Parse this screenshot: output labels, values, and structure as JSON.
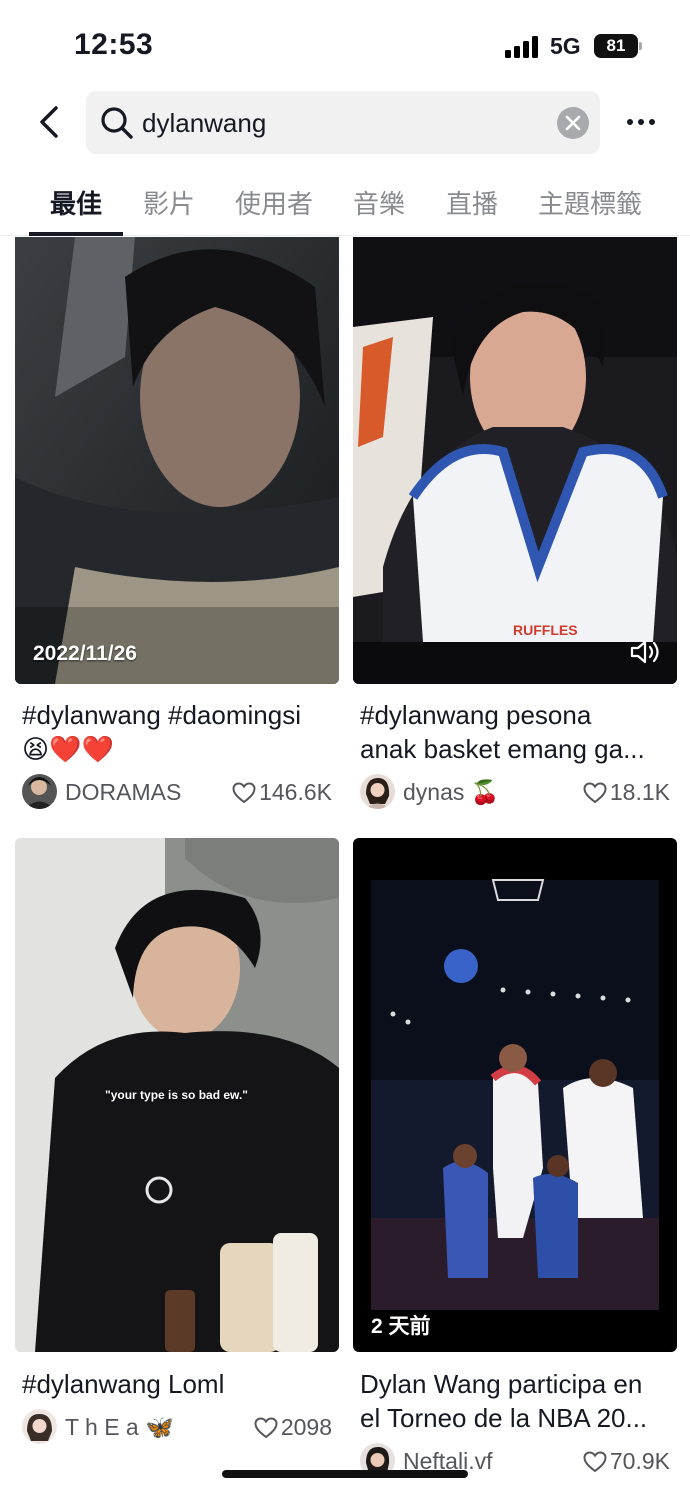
{
  "status_bar": {
    "time": "12:53",
    "network": "5G",
    "battery": "81"
  },
  "search": {
    "query": "dylanwang"
  },
  "tabs": [
    {
      "label": "最佳",
      "active": true
    },
    {
      "label": "影片"
    },
    {
      "label": "使用者"
    },
    {
      "label": "音樂"
    },
    {
      "label": "直播"
    },
    {
      "label": "主題標籤"
    }
  ],
  "results": [
    {
      "overlay": "2022/11/26",
      "caption_line1": "#dylanwang #daomingsi",
      "caption_line2": "😫❤️❤️",
      "username": "DORAMAS",
      "likes": "146.6K"
    },
    {
      "caption_line1": "#dylanwang pesona",
      "caption_line2": "anak basket emang ga...",
      "username": "dynas 🍒",
      "likes": "18.1K",
      "thumb_text": "RUFFLES"
    },
    {
      "thumb_text": "\"your type is so bad ew.\"",
      "caption_line1": "#dylanwang Loml",
      "username": "T h E a 🦋",
      "likes": "2098"
    },
    {
      "overlay": "2 天前",
      "caption_line1": "Dylan Wang participa en",
      "caption_line2": "el Torneo de la NBA 20...",
      "username": "Neftali.vf",
      "likes": "70.9K"
    }
  ],
  "icons": {
    "back": "chevron-left-icon",
    "search": "magnifier-icon",
    "clear": "close-circle-icon",
    "more": "ellipsis-icon",
    "like": "heart-outline-icon",
    "sound": "speaker-icon"
  },
  "colors": {
    "tab_active": "#161823",
    "tab_inactive": "#8a8b91",
    "search_bg": "#f1f1f2"
  }
}
